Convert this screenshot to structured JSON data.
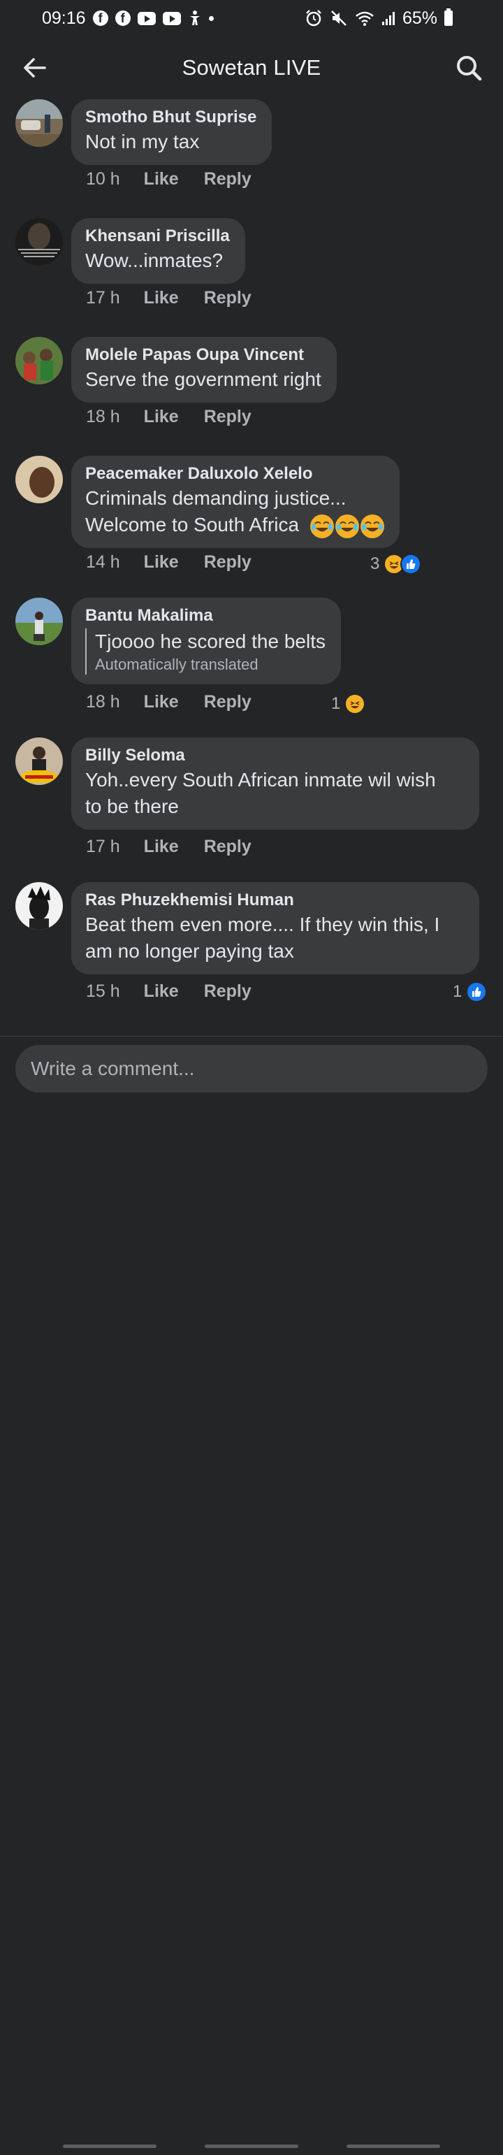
{
  "status_bar": {
    "time": "09:16",
    "battery": "65%",
    "left_icons": [
      "facebook-icon",
      "facebook-icon",
      "youtube-icon",
      "youtube-icon",
      "accessibility-icon",
      "dot-icon"
    ],
    "right_icons": [
      "alarm-icon",
      "mute-icon",
      "wifi-icon",
      "signal-icon",
      "battery-icon"
    ]
  },
  "app_bar": {
    "title": "Sowetan LIVE",
    "back_icon": "arrow-left-icon",
    "search_icon": "search-icon"
  },
  "comments": [
    {
      "author": "Smotho Bhut Suprise",
      "text": "Not in my tax",
      "time": "10 h",
      "like_label": "Like",
      "reply_label": "Reply"
    },
    {
      "author": "Khensani Priscilla",
      "text": "Wow...inmates?",
      "time": "17 h",
      "like_label": "Like",
      "reply_label": "Reply"
    },
    {
      "author": "Molele Papas Oupa Vincent",
      "text": "Serve the government right",
      "time": "18 h",
      "like_label": "Like",
      "reply_label": "Reply"
    },
    {
      "author": "Peacemaker Daluxolo Xelelo",
      "text_line1": "Criminals demanding justice...",
      "text_line2": "Welcome to South Africa",
      "emojis": [
        "tears-of-joy-emoji",
        "tears-of-joy-emoji",
        "tears-of-joy-emoji"
      ],
      "time": "14 h",
      "like_label": "Like",
      "reply_label": "Reply",
      "reaction_count": "3",
      "reaction_icons": [
        "haha-reaction-icon",
        "like-reaction-icon"
      ]
    },
    {
      "author": "Bantu Makalima",
      "text": "Tjoooo he scored the belts",
      "translation_note": "Automatically translated",
      "time": "18 h",
      "like_label": "Like",
      "reply_label": "Reply",
      "reaction_count": "1",
      "reaction_icons": [
        "haha-reaction-icon"
      ]
    },
    {
      "author": "Billy Seloma",
      "text_line1": "Yoh..every South African inmate wil wish",
      "text_line2": "to be there",
      "time": "17 h",
      "like_label": "Like",
      "reply_label": "Reply"
    },
    {
      "author": "Ras Phuzekhemisi Human",
      "text_line1": "Beat them even more.... If they win this, I",
      "text_line2": "am no longer paying tax",
      "time": "15 h",
      "like_label": "Like",
      "reply_label": "Reply",
      "reaction_count": "1",
      "reaction_icons": [
        "like-reaction-icon"
      ]
    }
  ],
  "composer": {
    "placeholder": "Write a comment..."
  },
  "colors": {
    "background": "#242526",
    "bubble": "#3a3b3c",
    "primary_text": "#e4e6eb",
    "secondary_text": "#b0b3b8",
    "like_blue": "#1877f2",
    "haha_yellow": "#f7b125"
  }
}
